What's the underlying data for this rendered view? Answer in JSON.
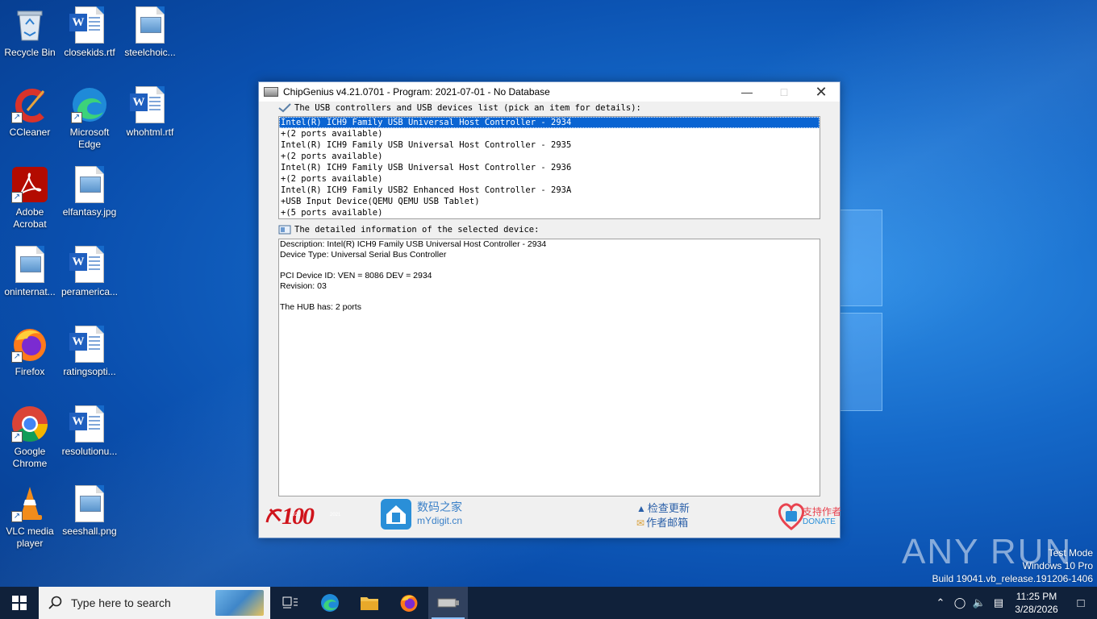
{
  "desktop": {
    "icons": [
      {
        "label": "Recycle Bin"
      },
      {
        "label": "closekids.rtf"
      },
      {
        "label": "steelchoic..."
      },
      {
        "label": "CCleaner"
      },
      {
        "label": "Microsoft Edge"
      },
      {
        "label": "whohtml.rtf"
      },
      {
        "label": "Adobe Acrobat"
      },
      {
        "label": "elfantasy.jpg"
      },
      {
        "label": "oninternat..."
      },
      {
        "label": "peramerica..."
      },
      {
        "label": "Firefox"
      },
      {
        "label": "ratingsopti..."
      },
      {
        "label": "Google Chrome"
      },
      {
        "label": "resolutionu..."
      },
      {
        "label": "VLC media player"
      },
      {
        "label": "seeshall.png"
      }
    ]
  },
  "window": {
    "title": "ChipGenius v4.21.0701 - Program: 2021-07-01 - No Database",
    "list_header": "The USB controllers and USB devices list (pick an item for details):",
    "devices": [
      "Intel(R) ICH9 Family USB Universal Host Controller - 2934",
      "+(2 ports available)",
      "Intel(R) ICH9 Family USB Universal Host Controller - 2935",
      "+(2 ports available)",
      "Intel(R) ICH9 Family USB Universal Host Controller - 2936",
      "+(2 ports available)",
      "Intel(R) ICH9 Family USB2 Enhanced Host Controller - 293A",
      "+USB Input Device(QEMU QEMU USB Tablet)",
      "+(5 ports available)"
    ],
    "detail_header": "The detailed information of the selected device:",
    "details": {
      "description": "Description: Intel(R) ICH9 Family USB Universal Host Controller - 2934",
      "device_type": "Device Type: Universal Serial Bus Controller",
      "pci_id": "PCI Device ID: VEN = 8086 DEV = 2934",
      "revision": "Revision: 03",
      "hub": "The HUB has: 2 ports"
    },
    "footer": {
      "badge_year_left": "1921",
      "badge_number": "100",
      "badge_year_right": "2021",
      "site_name": "数码之家",
      "site_url": "mYdigit.cn",
      "check_update": "检查更新",
      "author_email": "作者邮箱",
      "support_author": "支持作者",
      "donate": "DONATE"
    }
  },
  "taskbar": {
    "search_placeholder": "Type here to search",
    "time": "11:25 PM",
    "date": "3/28/2026"
  },
  "watermark": {
    "mode": "Test Mode",
    "edition": "Windows 10 Pro",
    "build": "Build 19041.vb_release.191206-1406",
    "brand": "ANY RUN"
  }
}
